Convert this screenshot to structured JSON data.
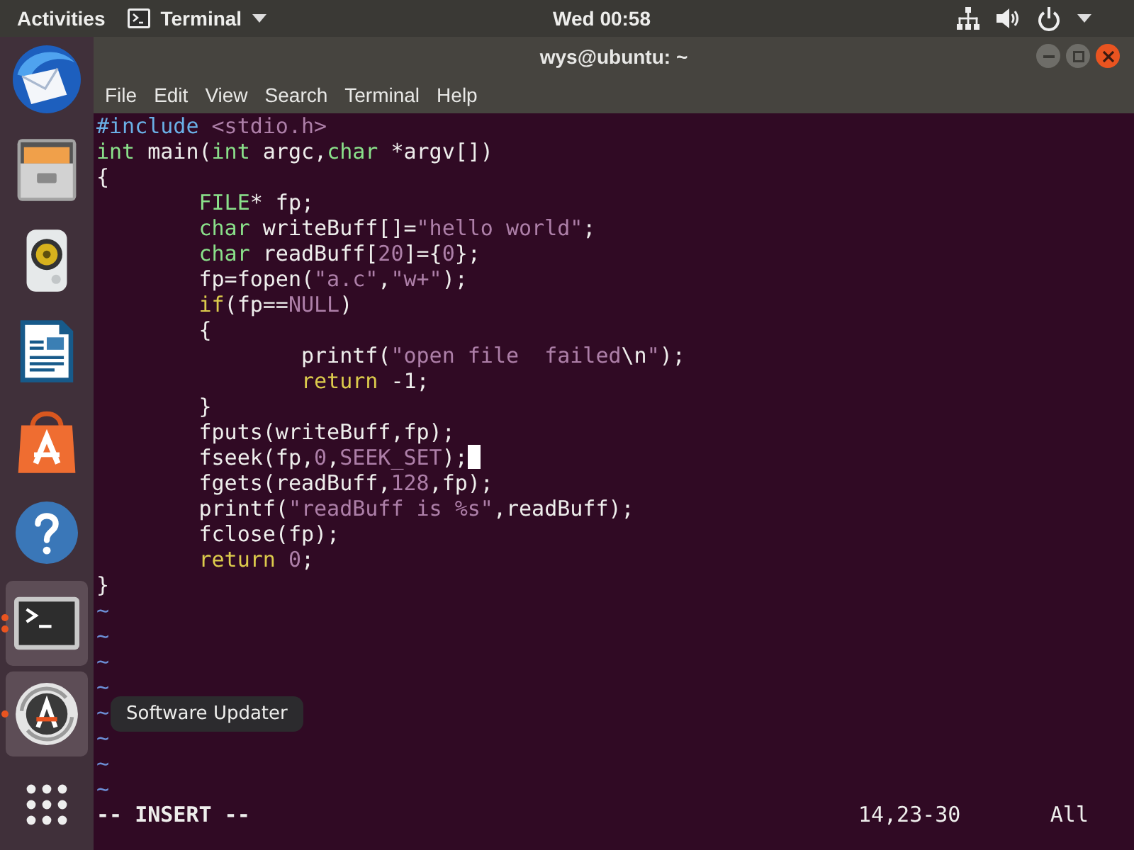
{
  "top_bar": {
    "activities": "Activities",
    "app_menu": "Terminal",
    "clock": "Wed 00:58"
  },
  "dock": [
    {
      "highlighted": false,
      "running": false
    },
    {
      "highlighted": false,
      "running": false
    },
    {
      "highlighted": false,
      "running": false
    },
    {
      "highlighted": false,
      "running": false
    },
    {
      "highlighted": false,
      "running": false
    },
    {
      "highlighted": false,
      "running": false
    },
    {
      "highlighted": true,
      "running": true,
      "multiple_windows": true
    },
    {
      "highlighted": true,
      "running": true,
      "multiple_windows": false,
      "tooltip": "Software Updater"
    }
  ],
  "window": {
    "title": "wys@ubuntu: ~",
    "menu": [
      "File",
      "Edit",
      "View",
      "Search",
      "Terminal",
      "Help"
    ],
    "editor": {
      "code_lines": [
        {
          "cursor": false,
          "segments": [
            {
              "kind": "preproc",
              "text": "#include "
            },
            {
              "kind": "include",
              "text": "<stdio.h>"
            }
          ]
        },
        {
          "cursor": false,
          "segments": [
            {
              "kind": "type",
              "text": "int"
            },
            {
              "kind": "plain",
              "text": " main("
            },
            {
              "kind": "type",
              "text": "int"
            },
            {
              "kind": "plain",
              "text": " argc,"
            },
            {
              "kind": "type",
              "text": "char"
            },
            {
              "kind": "plain",
              "text": " *argv[])"
            }
          ]
        },
        {
          "cursor": false,
          "segments": [
            {
              "kind": "plain",
              "text": "{"
            }
          ]
        },
        {
          "cursor": false,
          "segments": [
            {
              "kind": "type",
              "text": "\tFILE"
            },
            {
              "kind": "plain",
              "text": "* fp;"
            }
          ]
        },
        {
          "cursor": false,
          "segments": [
            {
              "kind": "type",
              "text": "\tchar"
            },
            {
              "kind": "plain",
              "text": " writeBuff[]="
            },
            {
              "kind": "string",
              "text": "\"hello world\""
            },
            {
              "kind": "plain",
              "text": ";"
            }
          ]
        },
        {
          "cursor": false,
          "segments": [
            {
              "kind": "type",
              "text": "\tchar"
            },
            {
              "kind": "plain",
              "text": " readBuff["
            },
            {
              "kind": "number",
              "text": "20"
            },
            {
              "kind": "plain",
              "text": "]={"
            },
            {
              "kind": "number",
              "text": "0"
            },
            {
              "kind": "plain",
              "text": "};"
            }
          ]
        },
        {
          "cursor": false,
          "segments": [
            {
              "kind": "plain",
              "text": "\tfp=fopen("
            },
            {
              "kind": "string",
              "text": "\"a.c\""
            },
            {
              "kind": "plain",
              "text": ","
            },
            {
              "kind": "string",
              "text": "\"w+\""
            },
            {
              "kind": "plain",
              "text": ");"
            }
          ]
        },
        {
          "cursor": false,
          "segments": [
            {
              "kind": "keyword",
              "text": "\tif"
            },
            {
              "kind": "plain",
              "text": "(fp=="
            },
            {
              "kind": "constant",
              "text": "NULL"
            },
            {
              "kind": "plain",
              "text": ")"
            }
          ]
        },
        {
          "cursor": false,
          "segments": [
            {
              "kind": "plain",
              "text": "\t{"
            }
          ]
        },
        {
          "cursor": false,
          "segments": [
            {
              "kind": "plain",
              "text": "\t\tprintf("
            },
            {
              "kind": "string",
              "text": "\"open file  failed"
            },
            {
              "kind": "special",
              "text": "\\n"
            },
            {
              "kind": "string",
              "text": "\""
            },
            {
              "kind": "plain",
              "text": ");"
            }
          ]
        },
        {
          "cursor": false,
          "segments": [
            {
              "kind": "keyword",
              "text": "\t\treturn"
            },
            {
              "kind": "plain",
              "text": " -1;"
            }
          ]
        },
        {
          "cursor": false,
          "segments": [
            {
              "kind": "plain",
              "text": "\t}"
            }
          ]
        },
        {
          "cursor": false,
          "segments": [
            {
              "kind": "plain",
              "text": "\tfputs(writeBuff,fp);"
            }
          ]
        },
        {
          "cursor": true,
          "segments": [
            {
              "kind": "plain",
              "text": "\tfseek(fp,"
            },
            {
              "kind": "number",
              "text": "0"
            },
            {
              "kind": "plain",
              "text": ","
            },
            {
              "kind": "constant",
              "text": "SEEK_SET"
            },
            {
              "kind": "plain",
              "text": ");"
            }
          ]
        },
        {
          "cursor": false,
          "segments": [
            {
              "kind": "plain",
              "text": "\tfgets(readBuff,"
            },
            {
              "kind": "number",
              "text": "128"
            },
            {
              "kind": "plain",
              "text": ",fp);"
            }
          ]
        },
        {
          "cursor": false,
          "segments": [
            {
              "kind": "plain",
              "text": "\tprintf("
            },
            {
              "kind": "string",
              "text": "\"readBuff is %s\""
            },
            {
              "kind": "plain",
              "text": ",readBuff);"
            }
          ]
        },
        {
          "cursor": false,
          "segments": [
            {
              "kind": "plain",
              "text": "\tfclose(fp);"
            }
          ]
        },
        {
          "cursor": false,
          "segments": [
            {
              "kind": "keyword",
              "text": "\treturn "
            },
            {
              "kind": "number",
              "text": "0"
            },
            {
              "kind": "plain",
              "text": ";"
            }
          ]
        },
        {
          "cursor": false,
          "segments": [
            {
              "kind": "plain",
              "text": "}"
            }
          ]
        }
      ],
      "filler_lines": [
        "~",
        "~",
        "~",
        "~",
        "~",
        "~",
        "~",
        "~"
      ],
      "status": {
        "mode": "-- INSERT --",
        "position": "14,23-30",
        "scroll": "All"
      }
    }
  }
}
